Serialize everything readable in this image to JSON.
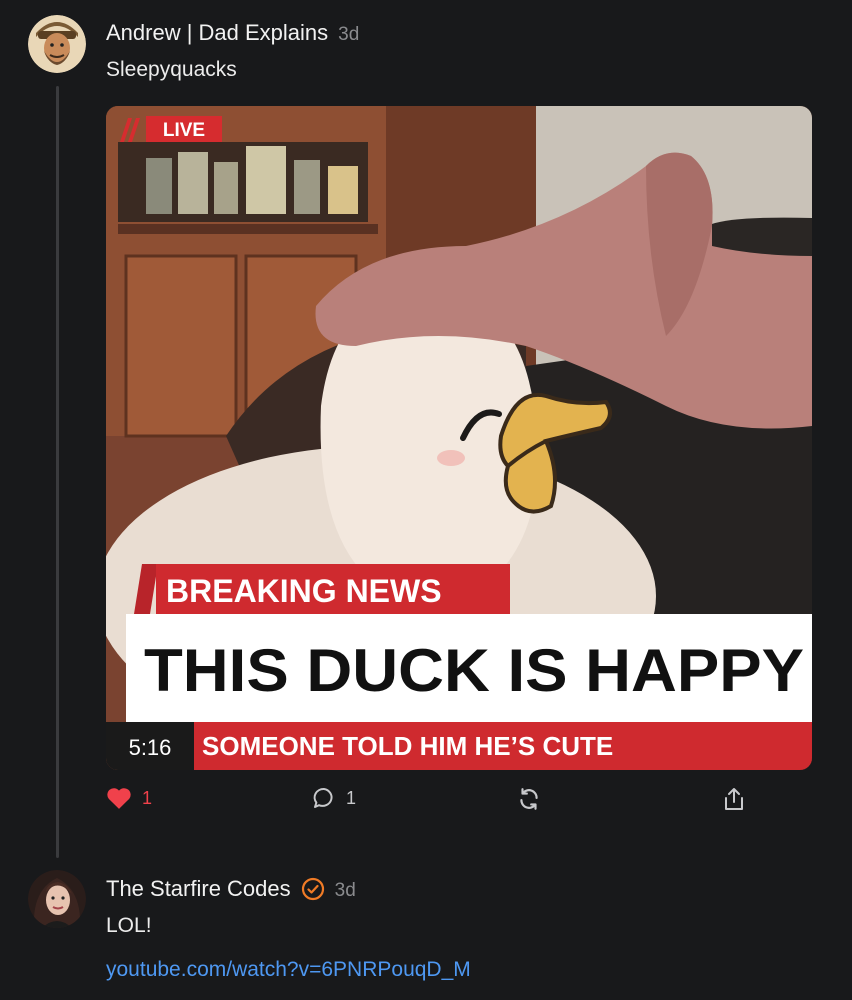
{
  "post1": {
    "author": "Andrew | Dad Explains",
    "time": "3d",
    "text": "Sleepyquacks",
    "media": {
      "live_tag": "LIVE",
      "breaking": "BREAKING NEWS",
      "headline": "THIS DUCK IS HAPPY",
      "timestamp": "5:16",
      "ticker": "SOMEONE TOLD HIM HE’S CUTE"
    },
    "actions": {
      "likes": "1",
      "replies": "1"
    }
  },
  "post2": {
    "author": "The Starfire Codes",
    "time": "3d",
    "text": "LOL!",
    "link": "youtube.com/watch?v=6PNRPouqD_M"
  },
  "colors": {
    "background": "#18191b",
    "like": "#f0414b",
    "link": "#4e98f2",
    "verified": "#f07b26",
    "news_red": "#cf2a2f"
  },
  "icons": [
    "heart-icon",
    "comment-icon",
    "repost-icon",
    "share-icon",
    "verified-icon"
  ]
}
